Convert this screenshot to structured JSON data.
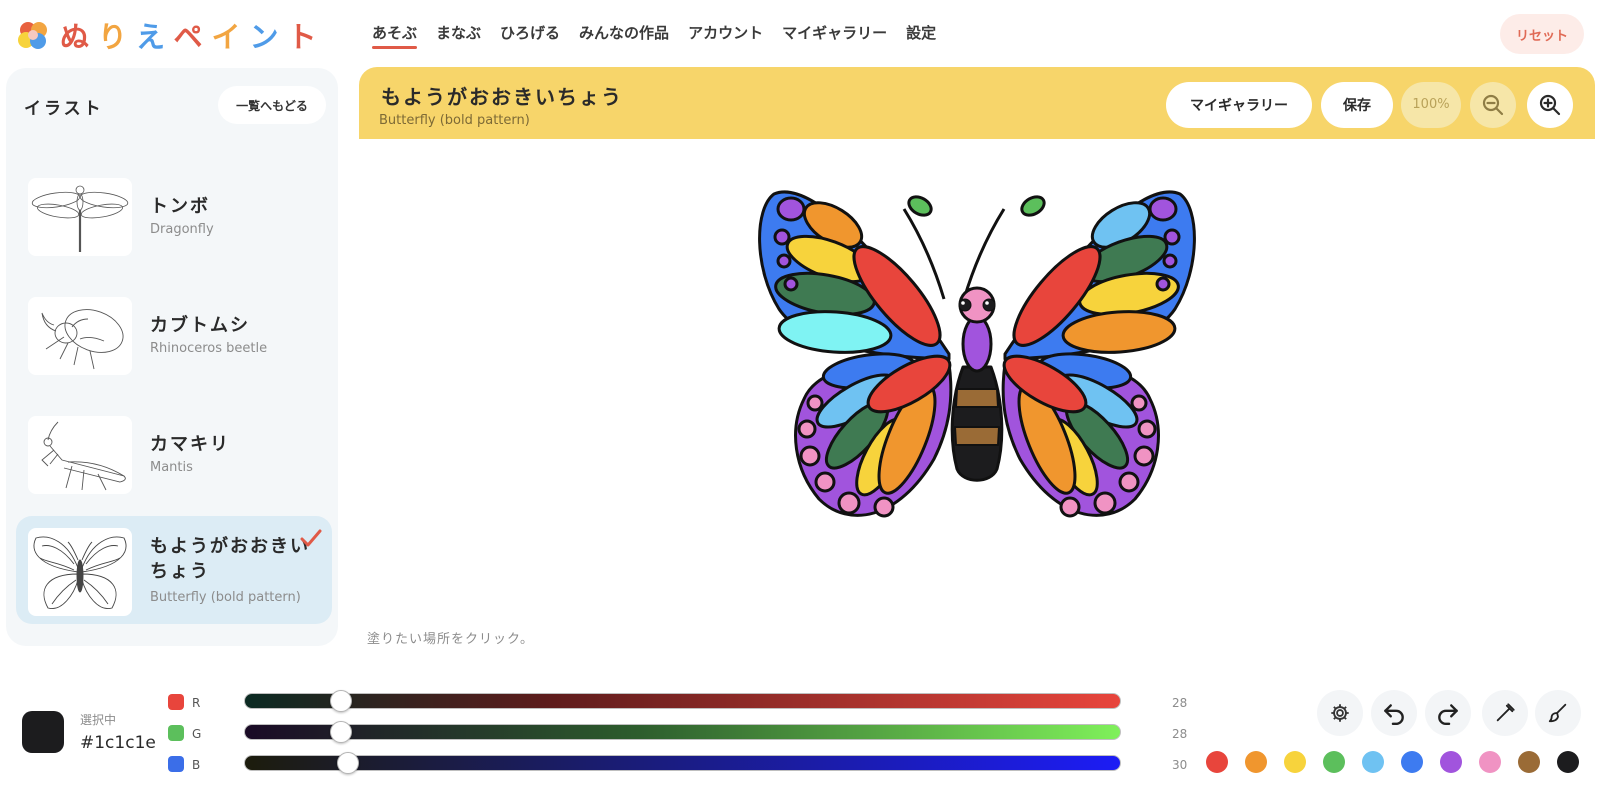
{
  "app": {
    "logo_text": "ぬりえペイント",
    "nav": [
      "あそぶ",
      "まなぶ",
      "ひろげる",
      "みんなの作品",
      "アカウント",
      "マイギャラリー",
      "設定"
    ],
    "reset_label": "リセット"
  },
  "sidebar": {
    "title": "イラスト",
    "back_label": "一覧へもどる",
    "items": [
      {
        "jp": "トンボ",
        "en": "Dragonfly",
        "selected": false
      },
      {
        "jp": "カブトムシ",
        "en": "Rhinoceros beetle",
        "selected": false
      },
      {
        "jp": "カマキリ",
        "en": "Mantis",
        "selected": false
      },
      {
        "jp": "もようがおおきいちょう",
        "en": "Butterfly (bold pattern)",
        "selected": true
      }
    ]
  },
  "banner": {
    "title": "もようがおおきいちょう",
    "subtitle": "Butterfly (bold pattern)",
    "gallery_label": "マイギャラリー",
    "save_label": "保存",
    "zoom_level": "100%"
  },
  "canvas": {
    "hint": "塗りたい場所をクリック。"
  },
  "color_picker": {
    "current_label": "選択中",
    "current_hex": "#1c1c1e",
    "channels": [
      {
        "label": "R",
        "value": 28,
        "dot_color": "#e8453c"
      },
      {
        "label": "G",
        "value": 28,
        "dot_color": "#5cbf5c"
      },
      {
        "label": "B",
        "value": 30,
        "dot_color": "#3b6ee8"
      }
    ]
  },
  "tools": [
    "gear-icon",
    "undo-icon",
    "redo-icon",
    "eyedropper-icon",
    "brush-icon"
  ],
  "palette": [
    "#e8453c",
    "#f0962e",
    "#f7d33c",
    "#5cbf5c",
    "#6fc2f2",
    "#3d7bf0",
    "#a154dd",
    "#f093c3",
    "#9a6b36",
    "#1c1c1e"
  ]
}
